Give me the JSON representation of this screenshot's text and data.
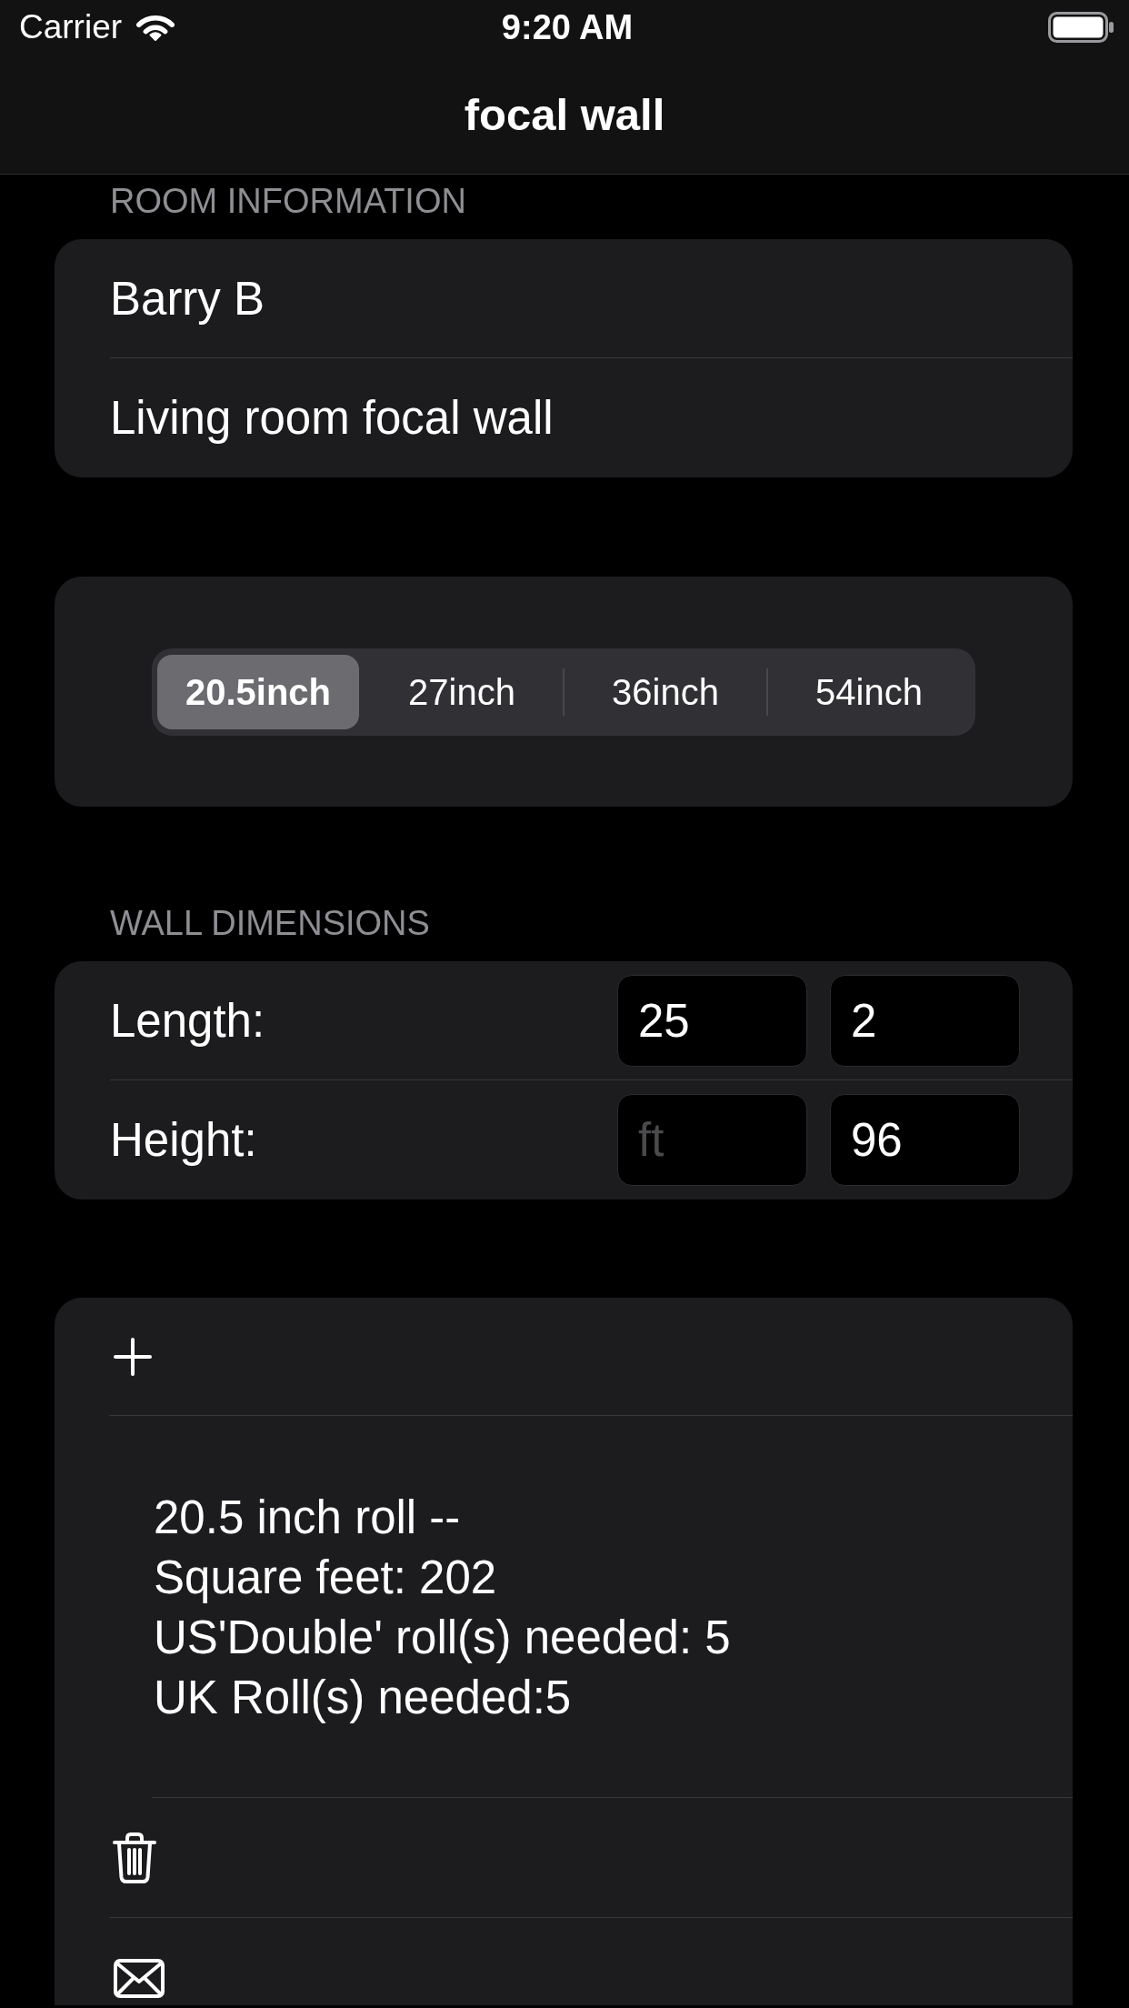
{
  "status_bar": {
    "carrier": "Carrier",
    "time": "9:20 AM"
  },
  "navigation_bar": {
    "title": "focal wall"
  },
  "room_information": {
    "header": "ROOM INFORMATION",
    "fields": [
      {
        "value": "Barry B"
      },
      {
        "value": "Living room focal wall"
      }
    ]
  },
  "roll_width": {
    "segments": [
      {
        "label": "20.5inch",
        "selected": true
      },
      {
        "label": "27inch",
        "selected": false
      },
      {
        "label": "36inch",
        "selected": false
      },
      {
        "label": "54inch",
        "selected": false
      }
    ]
  },
  "wall_dimensions": {
    "header": "WALL DIMENSIONS",
    "rows": [
      {
        "label": "Length:",
        "fields": [
          {
            "value": "25"
          },
          {
            "value": "2"
          }
        ]
      },
      {
        "label": "Height:",
        "fields": [
          {
            "placeholder": "ft"
          },
          {
            "value": "96"
          }
        ]
      }
    ]
  },
  "results": {
    "rows": [
      {
        "kind": "add"
      },
      {
        "kind": "summary",
        "lines": [
          "20.5 inch roll --",
          "Square feet: 202",
          "US'Double' roll(s) needed: 5",
          "UK Roll(s) needed:5"
        ]
      },
      {
        "kind": "delete"
      },
      {
        "kind": "mail"
      }
    ]
  }
}
